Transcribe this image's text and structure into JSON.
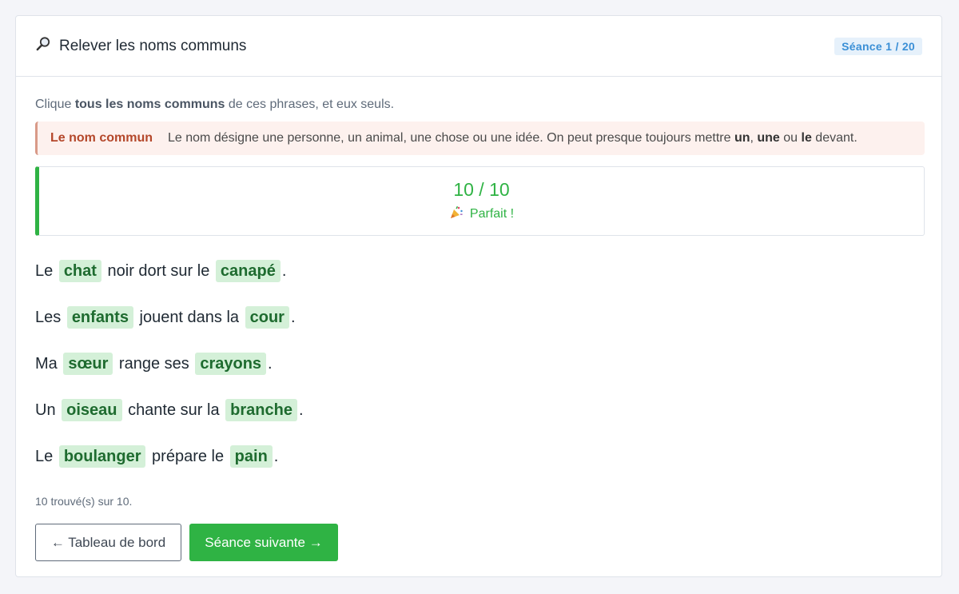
{
  "header": {
    "icon": "magnifier-icon",
    "title": "Relever les noms communs",
    "session": "Séance 1 / 20"
  },
  "instruction": {
    "prefix": "Clique ",
    "bold": "tous les noms communs",
    "suffix": " de ces phrases, et eux seuls."
  },
  "rule": {
    "label": "Le nom commun",
    "text_a": "Le nom désigne une personne, un animal, une chose ou une idée. On peut presque toujours mettre ",
    "bold_un": "un",
    "sep_1": ", ",
    "bold_une": "une",
    "sep_2": " ou ",
    "bold_le": "le",
    "text_b": " devant."
  },
  "score": {
    "value": "10 / 10",
    "icon": "party-popper-icon",
    "message": "Parfait !"
  },
  "sentences": [
    [
      {
        "t": "Le",
        "n": false
      },
      {
        "t": "chat",
        "n": true
      },
      {
        "t": "noir dort sur le",
        "n": false
      },
      {
        "t": "canapé",
        "n": true
      },
      {
        "t": ".",
        "n": false
      }
    ],
    [
      {
        "t": "Les",
        "n": false
      },
      {
        "t": "enfants",
        "n": true
      },
      {
        "t": "jouent dans la",
        "n": false
      },
      {
        "t": "cour",
        "n": true
      },
      {
        "t": ".",
        "n": false
      }
    ],
    [
      {
        "t": "Ma",
        "n": false
      },
      {
        "t": "sœur",
        "n": true
      },
      {
        "t": "range ses",
        "n": false
      },
      {
        "t": "crayons",
        "n": true
      },
      {
        "t": ".",
        "n": false
      }
    ],
    [
      {
        "t": "Un",
        "n": false
      },
      {
        "t": "oiseau",
        "n": true
      },
      {
        "t": "chante sur la",
        "n": false
      },
      {
        "t": "branche",
        "n": true
      },
      {
        "t": ".",
        "n": false
      }
    ],
    [
      {
        "t": "Le",
        "n": false
      },
      {
        "t": "boulanger",
        "n": true
      },
      {
        "t": "prépare le",
        "n": false
      },
      {
        "t": "pain",
        "n": true
      },
      {
        "t": ".",
        "n": false
      }
    ]
  ],
  "found_text": "10 trouvé(s) sur 10.",
  "buttons": {
    "back": "← Tableau de bord",
    "next": "Séance suivante →"
  },
  "colors": {
    "accent_green": "#2fb344",
    "noun_bg": "#d4f0d8",
    "rule_label": "#b4472a",
    "badge_blue": "#3a8fd6"
  }
}
